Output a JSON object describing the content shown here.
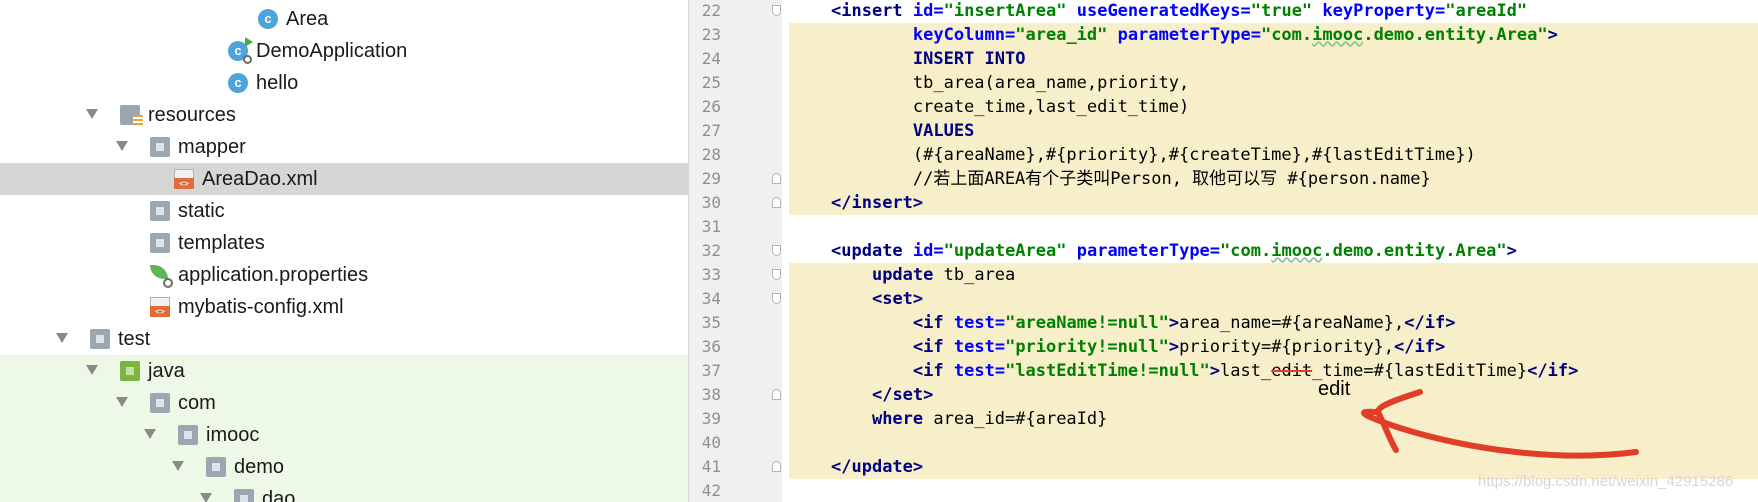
{
  "project_tree": {
    "items": [
      {
        "label": "Area",
        "icon": "class-icon"
      },
      {
        "label": "DemoApplication",
        "icon": "spring-boot-app-icon"
      },
      {
        "label": "hello",
        "icon": "class-icon"
      },
      {
        "label": "resources",
        "icon": "resources-folder-icon"
      },
      {
        "label": "mapper",
        "icon": "folder-icon"
      },
      {
        "label": "AreaDao.xml",
        "icon": "xml-file-icon",
        "selected": true
      },
      {
        "label": "static",
        "icon": "folder-icon"
      },
      {
        "label": "templates",
        "icon": "folder-icon"
      },
      {
        "label": "application.properties",
        "icon": "spring-properties-icon"
      },
      {
        "label": "mybatis-config.xml",
        "icon": "xml-file-icon"
      },
      {
        "label": "test",
        "icon": "folder-icon"
      },
      {
        "label": "java",
        "icon": "test-source-folder-icon"
      },
      {
        "label": "com",
        "icon": "package-icon"
      },
      {
        "label": "imooc",
        "icon": "package-icon"
      },
      {
        "label": "demo",
        "icon": "package-icon"
      },
      {
        "label": "dao",
        "icon": "package-icon"
      }
    ],
    "class_glyph": "c"
  },
  "editor": {
    "line_numbers": [
      "22",
      "23",
      "24",
      "25",
      "26",
      "27",
      "28",
      "29",
      "30",
      "31",
      "32",
      "33",
      "34",
      "35",
      "36",
      "37",
      "38",
      "39",
      "40",
      "41",
      "42"
    ],
    "lines": [
      [
        {
          "t": "<",
          "c": "tag"
        },
        {
          "t": "insert",
          "c": "tag"
        },
        {
          "t": " "
        },
        {
          "t": "id",
          "c": "attr"
        },
        {
          "t": "=",
          "c": "attr"
        },
        {
          "t": "\"insertArea\"",
          "c": "val"
        },
        {
          "t": " "
        },
        {
          "t": "useGeneratedKeys",
          "c": "attr"
        },
        {
          "t": "=",
          "c": "attr"
        },
        {
          "t": "\"true\"",
          "c": "val"
        },
        {
          "t": " "
        },
        {
          "t": "keyProperty",
          "c": "attr"
        },
        {
          "t": "=",
          "c": "attr"
        },
        {
          "t": "\"areaId\"",
          "c": "val"
        }
      ],
      [
        {
          "t": "        "
        },
        {
          "t": "keyColumn",
          "c": "attr"
        },
        {
          "t": "=",
          "c": "attr"
        },
        {
          "t": "\"area_id\"",
          "c": "val"
        },
        {
          "t": " "
        },
        {
          "t": "parameterType",
          "c": "attr"
        },
        {
          "t": "=",
          "c": "attr"
        },
        {
          "t": "\"com.",
          "c": "val"
        },
        {
          "t": "imooc",
          "c": "valwavy"
        },
        {
          "t": ".demo.entity.Area\"",
          "c": "val"
        },
        {
          "t": ">",
          "c": "tag"
        }
      ],
      [
        {
          "t": "        "
        },
        {
          "t": "INSERT INTO",
          "c": "sql"
        }
      ],
      [
        {
          "t": "        tb_area(area_name,priority,"
        }
      ],
      [
        {
          "t": "        create_time,last_edit_time)"
        }
      ],
      [
        {
          "t": "        "
        },
        {
          "t": "VALUES",
          "c": "sql"
        }
      ],
      [
        {
          "t": "        (#{areaName},#{priority},#{createTime},#{lastEditTime})"
        }
      ],
      [
        {
          "t": "        //若上面AREA有个子类叫Person, 取他可以写 #{person.name}"
        }
      ],
      [
        {
          "t": "</",
          "c": "tag"
        },
        {
          "t": "insert",
          "c": "tag"
        },
        {
          "t": ">",
          "c": "tag"
        }
      ],
      [],
      [
        {
          "t": "<",
          "c": "tag"
        },
        {
          "t": "update",
          "c": "tag"
        },
        {
          "t": " "
        },
        {
          "t": "id",
          "c": "attr"
        },
        {
          "t": "=",
          "c": "attr"
        },
        {
          "t": "\"updateArea\"",
          "c": "val"
        },
        {
          "t": " "
        },
        {
          "t": "parameterType",
          "c": "attr"
        },
        {
          "t": "=",
          "c": "attr"
        },
        {
          "t": "\"com.",
          "c": "val"
        },
        {
          "t": "imooc",
          "c": "valwavy"
        },
        {
          "t": ".demo.entity.Area\"",
          "c": "val"
        },
        {
          "t": ">",
          "c": "tag"
        }
      ],
      [
        {
          "t": "    "
        },
        {
          "t": "update",
          "c": "sql"
        },
        {
          "t": " tb_area"
        }
      ],
      [
        {
          "t": "    "
        },
        {
          "t": "<",
          "c": "tag"
        },
        {
          "t": "set",
          "c": "tag"
        },
        {
          "t": ">",
          "c": "tag"
        }
      ],
      [
        {
          "t": "        "
        },
        {
          "t": "<",
          "c": "tag"
        },
        {
          "t": "if",
          "c": "tag"
        },
        {
          "t": " "
        },
        {
          "t": "test",
          "c": "attr"
        },
        {
          "t": "=",
          "c": "attr"
        },
        {
          "t": "\"areaName!=null\"",
          "c": "val"
        },
        {
          "t": ">",
          "c": "tag"
        },
        {
          "t": "area_name=#{areaName},"
        },
        {
          "t": "</",
          "c": "tag"
        },
        {
          "t": "if",
          "c": "tag"
        },
        {
          "t": ">",
          "c": "tag"
        }
      ],
      [
        {
          "t": "        "
        },
        {
          "t": "<",
          "c": "tag"
        },
        {
          "t": "if",
          "c": "tag"
        },
        {
          "t": " "
        },
        {
          "t": "test",
          "c": "attr"
        },
        {
          "t": "=",
          "c": "attr"
        },
        {
          "t": "\"priority!=null\"",
          "c": "val"
        },
        {
          "t": ">",
          "c": "tag"
        },
        {
          "t": "priority=#{priority},"
        },
        {
          "t": "</",
          "c": "tag"
        },
        {
          "t": "if",
          "c": "tag"
        },
        {
          "t": ">",
          "c": "tag"
        }
      ],
      [
        {
          "t": "        "
        },
        {
          "t": "<",
          "c": "tag"
        },
        {
          "t": "if",
          "c": "tag"
        },
        {
          "t": " "
        },
        {
          "t": "test",
          "c": "attr"
        },
        {
          "t": "=",
          "c": "attr"
        },
        {
          "t": "\"lastEditTime!=null\"",
          "c": "val"
        },
        {
          "t": ">",
          "c": "tag"
        },
        {
          "t": "last_"
        },
        {
          "t": "edit",
          "c": "strike"
        },
        {
          "t": "_time=#{lastEditTime}"
        },
        {
          "t": "</",
          "c": "tag"
        },
        {
          "t": "if",
          "c": "tag"
        },
        {
          "t": ">",
          "c": "tag"
        }
      ],
      [
        {
          "t": "    "
        },
        {
          "t": "</",
          "c": "tag"
        },
        {
          "t": "set",
          "c": "tag"
        },
        {
          "t": ">",
          "c": "tag"
        }
      ],
      [
        {
          "t": "    "
        },
        {
          "t": "where",
          "c": "sql"
        },
        {
          "t": " area_id=#{areaId}"
        }
      ],
      [],
      [
        {
          "t": "</",
          "c": "tag"
        },
        {
          "t": "update",
          "c": "tag"
        },
        {
          "t": ">",
          "c": "tag"
        }
      ],
      []
    ]
  },
  "annotation": {
    "word": "edit",
    "color": "#e23d28"
  },
  "watermark": "https://blog.csdn.net/weixin_42915286",
  "colors": {
    "tag": "#000080",
    "attribute": "#0000ff",
    "value": "#008000",
    "highlight": "#f6efc9",
    "selected_row": "#d6d6d6",
    "test_folder_bg": "#eef8e6"
  }
}
